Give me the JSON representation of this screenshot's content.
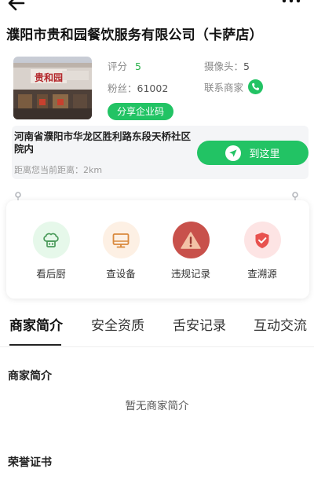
{
  "header": {
    "back_icon": "arrow-left-icon",
    "more_icon": "ellipsis-icon",
    "title": "濮阳市贵和园餐饮服务有限公司（卡萨店）"
  },
  "shop": {
    "photo_sign": "贵和园",
    "score_label": "评分",
    "score_value": "5",
    "camera_label": "摄像头：",
    "camera_value": "5",
    "fans_label": "粉丝：",
    "fans_value": "61002",
    "contact_label": "联系商家",
    "contact_icon": "phone-icon",
    "share_label": "分享企业码"
  },
  "address": {
    "text": "河南省濮阳市华龙区胜利路东段天桥社区院内",
    "distance": "距离您当前距离：2km",
    "goto_label": "到这里",
    "goto_icon": "navigation-arrow-icon"
  },
  "functions": [
    {
      "label": "看后厨",
      "icon": "chef-hat-icon"
    },
    {
      "label": "查设备",
      "icon": "monitor-icon"
    },
    {
      "label": "违规记录",
      "icon": "warning-icon"
    },
    {
      "label": "查溯源",
      "icon": "shield-check-icon"
    }
  ],
  "tabs": [
    "商家简介",
    "安全资质",
    "舌安记录",
    "互动交流"
  ],
  "active_tab": "商家简介",
  "content": {
    "intro_heading": "商家简介",
    "intro_empty": "暂无商家简介",
    "honor_heading": "荣誉证书"
  },
  "colors": {
    "accent_green": "#22c364",
    "score_green": "#2bb24c",
    "warning_red": "#c8514b"
  }
}
